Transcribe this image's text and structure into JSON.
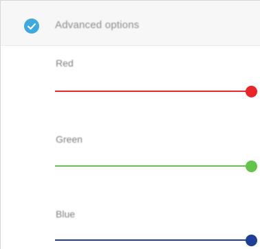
{
  "advanced": {
    "label": "Advanced options",
    "checked": true,
    "check_icon": "check-circle-icon",
    "check_color": "#3ea9df"
  },
  "sliders": [
    {
      "label": "Red",
      "value": 1.0,
      "color": "#e8262a"
    },
    {
      "label": "Green",
      "value": 1.0,
      "color": "#62c449"
    },
    {
      "label": "Blue",
      "value": 1.0,
      "color": "#1d3f95"
    }
  ]
}
